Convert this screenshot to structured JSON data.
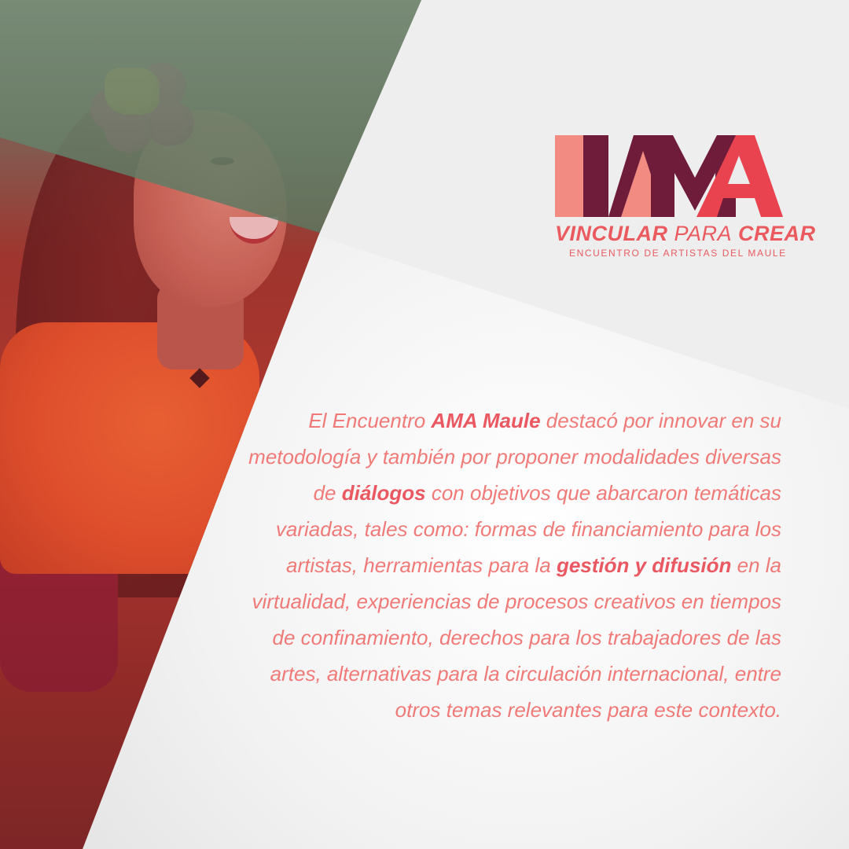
{
  "logo": {
    "mark_text": "AMA",
    "tagline_part1": "VINCULAR",
    "tagline_part2": "PARA",
    "tagline_part3": "CREAR",
    "subtitle": "ENCUENTRO DE ARTISTAS DEL MAULE"
  },
  "paragraph": {
    "s1": "El Encuentro ",
    "b1": "AMA Maule",
    "s2": " destacó por innovar en su metodología y también por proponer modalidades diversas de ",
    "b2": "diálogos",
    "s3": " con objetivos que abarcaron temáticas variadas, tales como: formas de financiamiento para los artistas, herramientas para la ",
    "b3": "gestión y difusión",
    "s4": " en la virtualidad, experiencias de procesos creativos en tiempos de confinamiento, derechos para los trabajadores de las artes, alternativas para la circulación internacional, entre otros temas relevantes para este contexto."
  },
  "colors": {
    "accent_pink": "#ea5a5e",
    "dark_maroon": "#6e1c3a",
    "light_coral": "#f28c82",
    "text_coral": "#f07a78"
  }
}
